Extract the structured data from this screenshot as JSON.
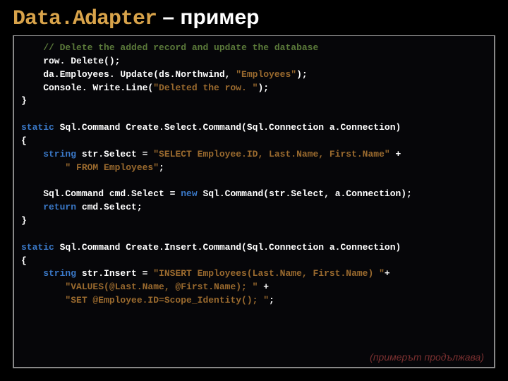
{
  "title": {
    "part1": "Data.Adapter",
    "dash": " – ",
    "part2": "пример"
  },
  "code": {
    "c1": "// Delete the added record and update the database",
    "l2": "    row. Delete();",
    "l3_a": "    da.Employees. Update(ds.Northwind, ",
    "l3_s": "\"Employees\"",
    "l3_b": ");",
    "l4_a": "    Console. Write.Line(",
    "l4_s": "\"Deleted the row. \"",
    "l4_b": ");",
    "l5": "}",
    "l7_k": "static",
    "l7_r": " Sql.Command Create.Select.Command(Sql.Connection a.Connection)",
    "l8": "{",
    "l9_k": "    string",
    "l9_a": " str.Select = ",
    "l9_s": "\"SELECT Employee.ID, Last.Name, First.Name\"",
    "l9_b": " +",
    "l10_s": "        \" FROM Employees\"",
    "l10_b": ";",
    "l12_a": "    Sql.Command cmd.Select = ",
    "l12_k": "new",
    "l12_b": " Sql.Command(str.Select, a.Connection);",
    "l13_k": "    return",
    "l13_a": " cmd.Select;",
    "l14": "}",
    "l16_k": "static",
    "l16_r": " Sql.Command Create.Insert.Command(Sql.Connection a.Connection)",
    "l17": "{",
    "l18_k": "    string",
    "l18_a": " str.Insert = ",
    "l18_s": "\"INSERT Employees(Last.Name, First.Name) \"",
    "l18_b": "+",
    "l19_s": "        \"VALUES(@Last.Name, @First.Name); \"",
    "l19_b": " +",
    "l20_s": "        \"SET @Employee.ID=Scope_Identity(); \"",
    "l20_b": ";"
  },
  "footer": "(примерът продължава)"
}
